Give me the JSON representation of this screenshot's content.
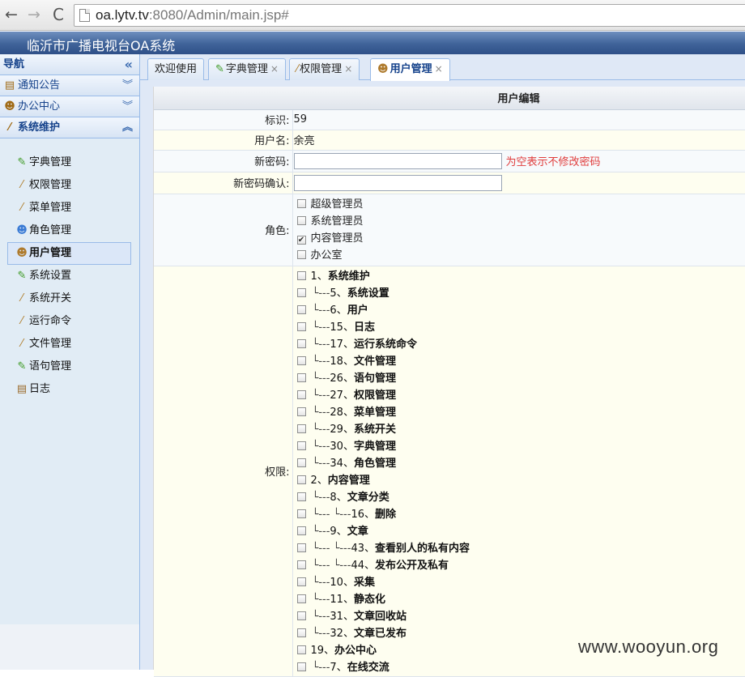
{
  "browser": {
    "back": "←",
    "forward": "→",
    "reload": "C",
    "url_host": "oa.lytv.tv",
    "url_rest": ":8080/Admin/main.jsp#"
  },
  "app": {
    "title": "临沂市广播电视台OA系统"
  },
  "sidebar": {
    "header": "导航",
    "collapse_icon": "«",
    "sections": [
      {
        "label": "通知公告",
        "icon": "note-icon",
        "chevron": "︾"
      },
      {
        "label": "办公中心",
        "icon": "user-icon",
        "chevron": "︾"
      },
      {
        "label": "系统维护",
        "icon": "wand-icon",
        "chevron": "︽"
      }
    ],
    "items": [
      {
        "label": "字典管理",
        "icon": "pencil-icon"
      },
      {
        "label": "权限管理",
        "icon": "wand-icon"
      },
      {
        "label": "菜单管理",
        "icon": "wand-icon"
      },
      {
        "label": "角色管理",
        "icon": "group-icon"
      },
      {
        "label": "用户管理",
        "icon": "user-icon",
        "active": true
      },
      {
        "label": "系统设置",
        "icon": "pencil-icon"
      },
      {
        "label": "系统开关",
        "icon": "wand-icon"
      },
      {
        "label": "运行命令",
        "icon": "wand-icon"
      },
      {
        "label": "文件管理",
        "icon": "wand-icon"
      },
      {
        "label": "语句管理",
        "icon": "pencil-icon"
      },
      {
        "label": "日志",
        "icon": "note-icon"
      }
    ]
  },
  "tabs": [
    {
      "label": "欢迎使用"
    },
    {
      "label": "字典管理",
      "close": "×"
    },
    {
      "label": "权限管理",
      "close": "×"
    },
    {
      "label": "用户管理",
      "close": "×",
      "active": true
    }
  ],
  "form": {
    "title": "用户编辑",
    "id_label": "标识:",
    "id_value": "59",
    "username_label": "用户名:",
    "username_value": "余亮",
    "new_password_label": "新密码:",
    "new_password_value": "",
    "password_hint": "为空表示不修改密码",
    "confirm_label": "新密码确认:",
    "confirm_value": "",
    "role_label": "角色:",
    "roles": [
      {
        "label": "超级管理员",
        "checked": false
      },
      {
        "label": "系统管理员",
        "checked": false
      },
      {
        "label": "内容管理员",
        "checked": true
      },
      {
        "label": "办公室",
        "checked": false
      }
    ],
    "perm_label": "权限:",
    "permissions": [
      {
        "prefix": "",
        "num": "1、",
        "name": "系统维护"
      },
      {
        "prefix": "└---",
        "num": "5、",
        "name": "系统设置"
      },
      {
        "prefix": "└---",
        "num": "6、",
        "name": "用户"
      },
      {
        "prefix": "└---",
        "num": "15、",
        "name": "日志"
      },
      {
        "prefix": "└---",
        "num": "17、",
        "name": "运行系统命令"
      },
      {
        "prefix": "└---",
        "num": "18、",
        "name": "文件管理"
      },
      {
        "prefix": "└---",
        "num": "26、",
        "name": "语句管理"
      },
      {
        "prefix": "└---",
        "num": "27、",
        "name": "权限管理"
      },
      {
        "prefix": "└---",
        "num": "28、",
        "name": "菜单管理"
      },
      {
        "prefix": "└---",
        "num": "29、",
        "name": "系统开关"
      },
      {
        "prefix": "└---",
        "num": "30、",
        "name": "字典管理"
      },
      {
        "prefix": "└---",
        "num": "34、",
        "name": "角色管理"
      },
      {
        "prefix": "",
        "num": "2、",
        "name": "内容管理"
      },
      {
        "prefix": "└---",
        "num": "8、",
        "name": "文章分类"
      },
      {
        "prefix": "└--- └---",
        "num": "16、",
        "name": "删除"
      },
      {
        "prefix": "└---",
        "num": "9、",
        "name": "文章"
      },
      {
        "prefix": "└--- └---",
        "num": "43、",
        "name": "查看别人的私有内容"
      },
      {
        "prefix": "└--- └---",
        "num": "44、",
        "name": "发布公开及私有"
      },
      {
        "prefix": "└---",
        "num": "10、",
        "name": "采集"
      },
      {
        "prefix": "└---",
        "num": "11、",
        "name": "静态化"
      },
      {
        "prefix": "└---",
        "num": "31、",
        "name": "文章回收站"
      },
      {
        "prefix": "└---",
        "num": "32、",
        "name": "文章已发布"
      },
      {
        "prefix": "",
        "num": "19、",
        "name": "办公中心"
      },
      {
        "prefix": "└---",
        "num": "7、",
        "name": "在线交流"
      }
    ]
  },
  "watermark": "www.wooyun.org"
}
